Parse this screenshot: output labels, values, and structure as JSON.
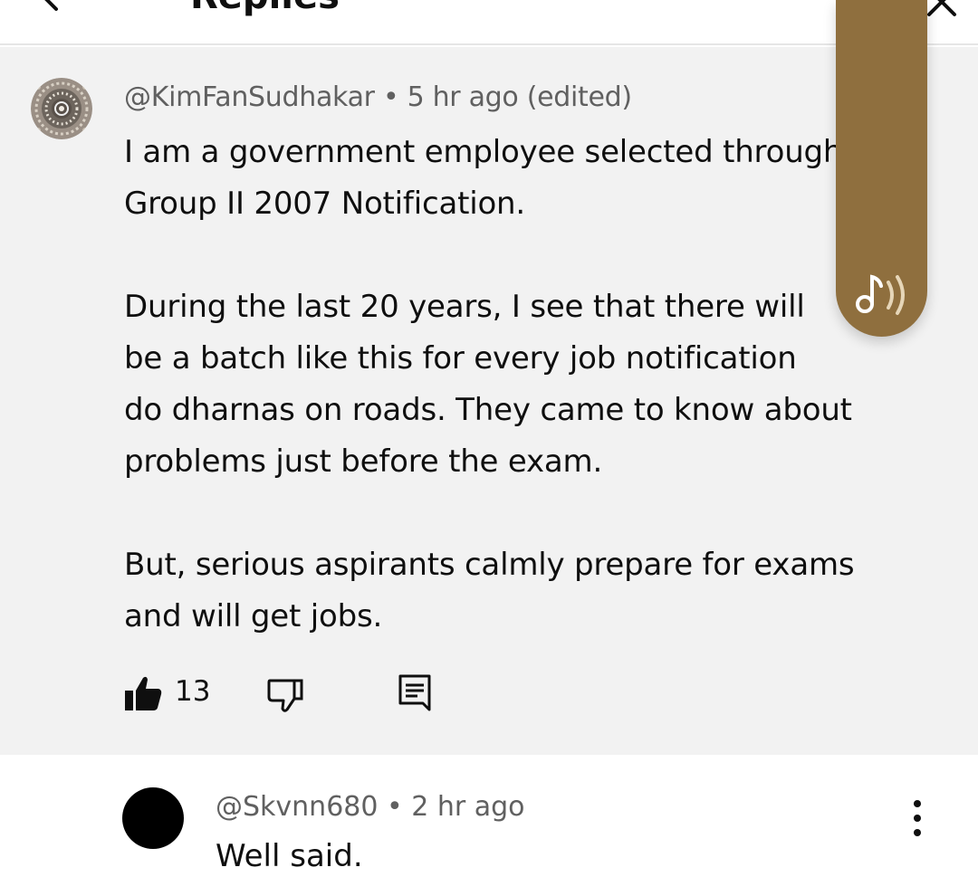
{
  "header": {
    "title": "Replies",
    "icons": [
      "back-arrow-icon",
      "close-icon"
    ]
  },
  "main_comment": {
    "author": "@KimFanSudhakar",
    "meta_suffix": " • 5 hr ago (edited)",
    "text": "I am a  government employee selected through\nGroup II 2007 Notification.\n\nDuring the last 20 years, I see that there will\nbe a batch like this for every job notification\ndo dharnas on roads. They came to know about\nproblems just before the exam.\n\nBut, serious aspirants calmly prepare for exams\nand will get jobs.",
    "like_count": "13",
    "icons": [
      "like-icon",
      "dislike-icon",
      "reply-icon"
    ]
  },
  "audio_pill": {
    "icon": "audio-icon",
    "color": "#8f6f3e"
  },
  "reply": {
    "author": "@Skvnn680",
    "meta_suffix": " • 2 hr ago",
    "text": "Well said.",
    "icon": "more-icon"
  },
  "colors": {
    "main_bg": "#f2f2f2",
    "meta_text": "#606060",
    "body_text": "#0f0f0f"
  }
}
